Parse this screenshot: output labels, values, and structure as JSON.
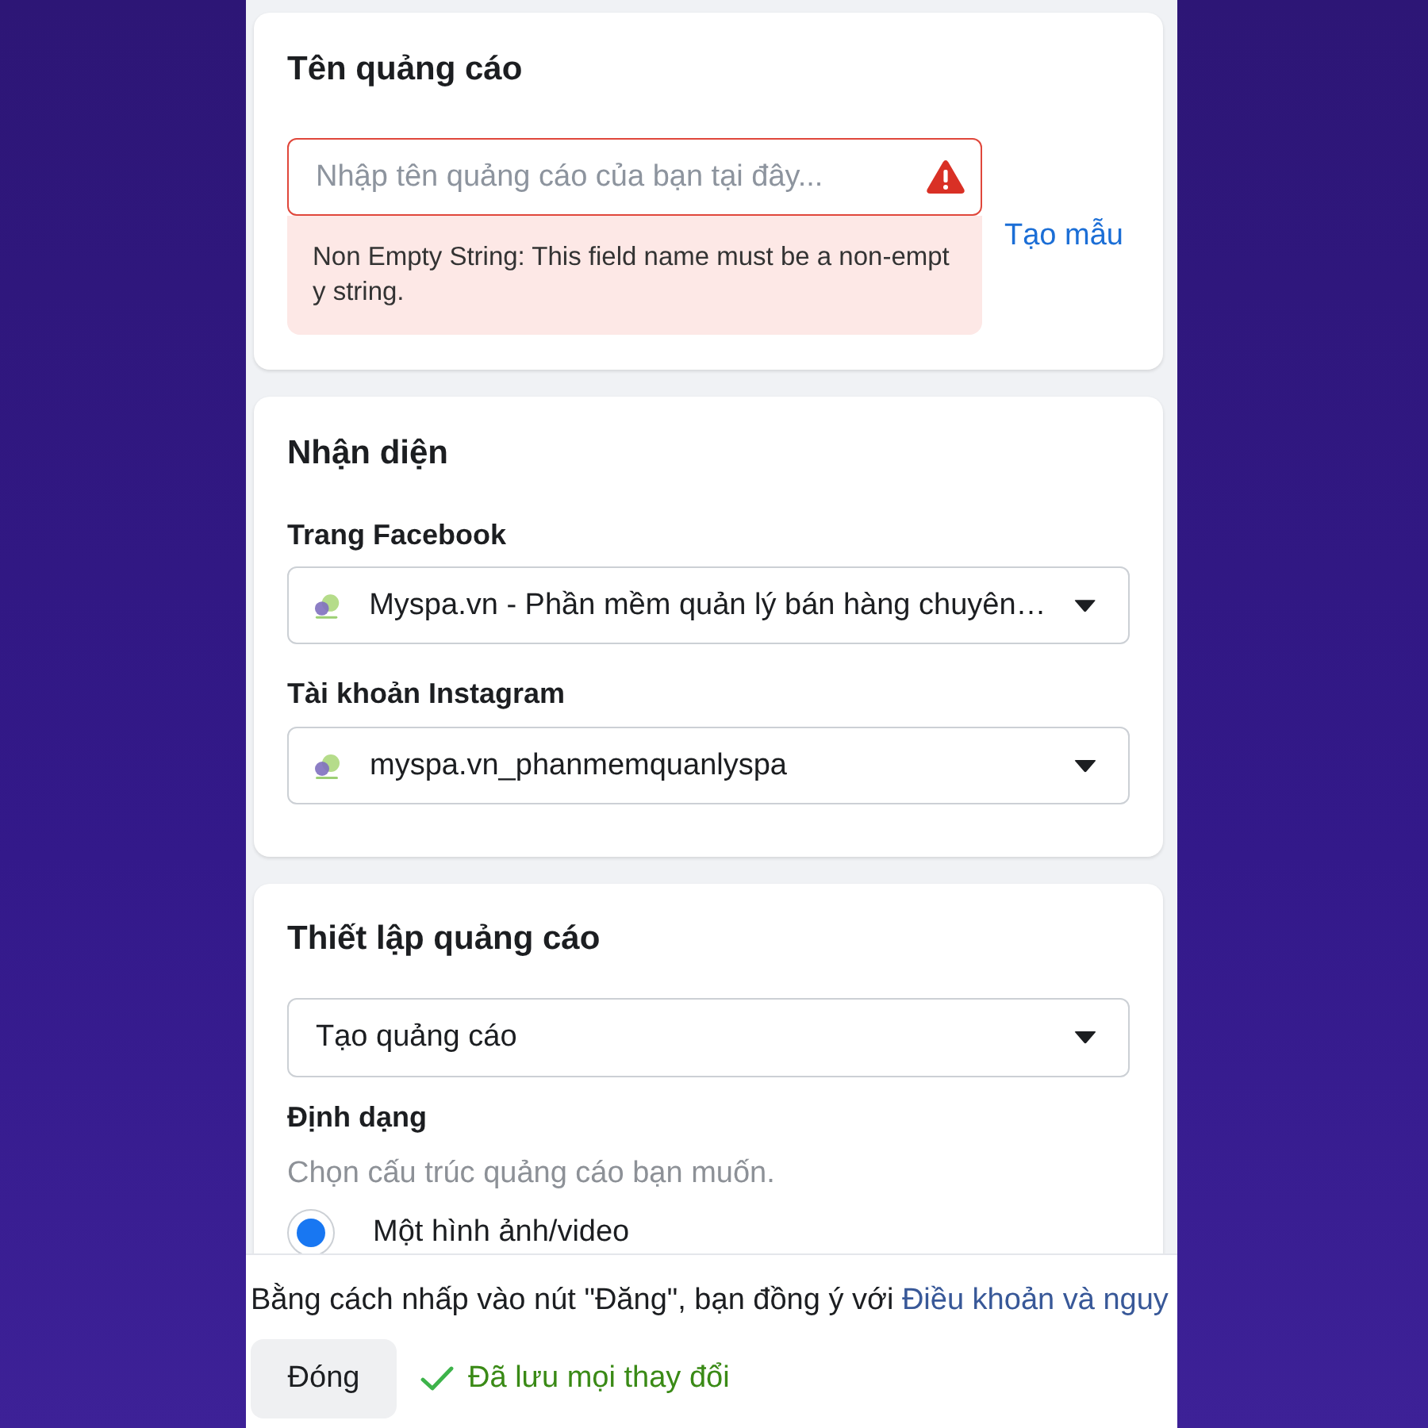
{
  "ad_name": {
    "title": "Tên quảng cáo",
    "input": {
      "placeholder": "Nhập tên quảng cáo của bạn tại đây...",
      "invalid": true
    },
    "error_message": "Non Empty String: This field name must be a non-empty string.",
    "template_link": "Tạo mẫu"
  },
  "identity": {
    "title": "Nhận diện",
    "fields": [
      {
        "label": "Trang Facebook",
        "value": "Myspa.vn - Phần mềm quản lý bán hàng chuyên…"
      },
      {
        "label": "Tài khoản Instagram",
        "value": "myspa.vn_phanmemquanlyspa"
      }
    ]
  },
  "setup": {
    "title": "Thiết lập quảng cáo",
    "mode_select": {
      "value": "Tạo quảng cáo"
    },
    "format": {
      "label": "Định dạng",
      "hint": "Chọn cấu trúc quảng cáo bạn muốn.",
      "options": [
        {
          "label": "Một hình ảnh/video",
          "selected": true
        }
      ]
    }
  },
  "footer": {
    "terms": {
      "text": "Bằng cách nhấp vào nút \"Đăng\", bạn đồng ý với",
      "link": "Điều khoản và nguy"
    },
    "close_button": "Đóng",
    "save_status": {
      "text": "Đã lưu mọi thay đổi",
      "saved": true
    }
  }
}
